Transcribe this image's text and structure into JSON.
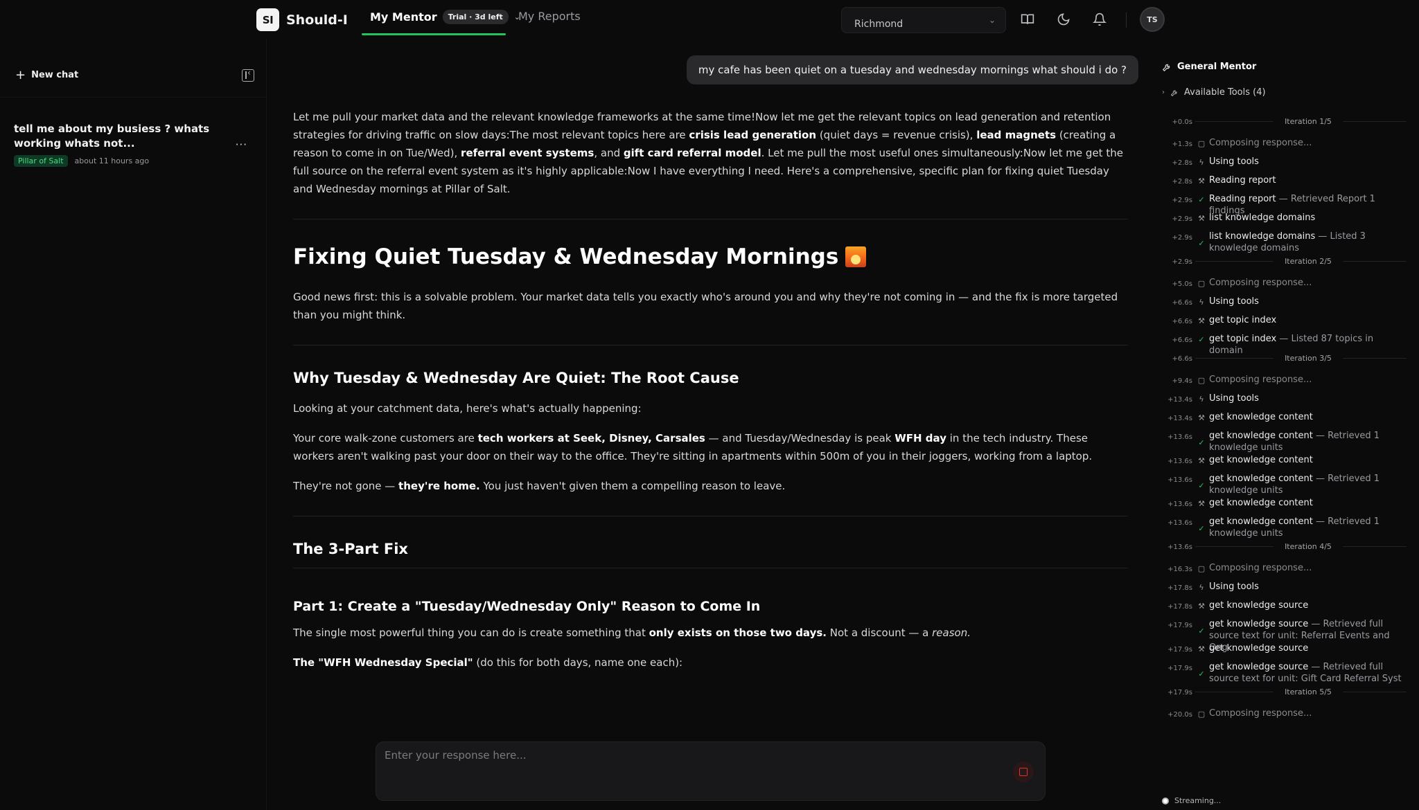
{
  "app": {
    "logo_mark": "SI",
    "name": "Should-I"
  },
  "nav": {
    "mentor_label": "My Mentor",
    "trial_badge": "Trial · 3d left",
    "reports_label": "My Reports",
    "active_color": "#22c55e"
  },
  "location": {
    "value": "Richmond"
  },
  "user": {
    "initials": "TS"
  },
  "sidebar": {
    "new_chat_label": "New chat",
    "chats": [
      {
        "title": "tell me about my busiess ? whats working whats not...",
        "tag": "Pillar of Salt",
        "time": "about 11 hours ago"
      }
    ]
  },
  "conversation": {
    "user_message": "my cafe has been quiet on a tuesday and wednesday mornings what should i do ?",
    "intro": {
      "t1": "Let me pull your market data and the relevant knowledge frameworks at the same time!Now let me get the relevant topics on lead generation and retention strategies for driving traffic on slow days:The most relevant topics here are ",
      "b1": "crisis lead generation",
      "t2": " (quiet days = revenue crisis), ",
      "b2": "lead magnets",
      "t3": " (creating a reason to come in on Tue/Wed), ",
      "b3": "referral event systems",
      "t4": ", and ",
      "b4": "gift card referral model",
      "t5": ". Let me pull the most useful ones simultaneously:Now let me get the full source on the referral event system as it's highly applicable:Now I have everything I need. Here's a comprehensive, specific plan for fixing quiet Tuesday and Wednesday mornings at Pillar of Salt."
    },
    "h1": "Fixing Quiet Tuesday & Wednesday Mornings",
    "good_news": "Good news first: this is a solvable problem. Your market data tells you exactly who's around you and why they're not coming in — and the fix is more targeted than you might think.",
    "h2_root": "Why Tuesday & Wednesday Are Quiet: The Root Cause",
    "catchment": "Looking at your catchment data, here's what's actually happening:",
    "walkzone": {
      "t1": "Your core walk-zone customers are ",
      "b1": "tech workers at Seek, Disney, Carsales",
      "t2": " — and Tuesday/Wednesday is peak ",
      "b2": "WFH day",
      "t3": " in the tech industry. These workers aren't walking past your door on their way to the office. They're sitting in apartments within 500m of you in their joggers, working from a laptop."
    },
    "not_gone": {
      "t1": "They're not gone — ",
      "b1": "they're home.",
      "t2": " You just haven't given them a compelling reason to leave."
    },
    "h2_fix": "The 3-Part Fix",
    "h3_part1": "Part 1: Create a \"Tuesday/Wednesday Only\" Reason to Come In",
    "powerful": {
      "t1": "The single most powerful thing you can do is create something that ",
      "b1": "only exists on those two days.",
      "t2": " Not a discount — a ",
      "i1": "reason."
    },
    "special": {
      "b1": "The \"WFH Wednesday Special\"",
      "t1": " (do this for both days, name one each):"
    }
  },
  "composer": {
    "placeholder": "Enter your response here...",
    "stop_color": "#dd3333"
  },
  "panel": {
    "title": "General Mentor",
    "tools_label": "Available Tools (4)",
    "streaming": "Streaming...",
    "timeline": [
      {
        "kind": "iter",
        "time": "+0.0s",
        "label": "Iteration 1/5"
      },
      {
        "kind": "compose",
        "time": "+1.3s",
        "text": "Composing response..."
      },
      {
        "kind": "tools",
        "time": "+2.8s",
        "text": "Using tools"
      },
      {
        "kind": "call",
        "time": "+2.8s",
        "text": "Reading report"
      },
      {
        "kind": "done",
        "time": "+2.9s",
        "text": "Reading report",
        "detail": " — Retrieved Report 1 findings"
      },
      {
        "kind": "call",
        "time": "+2.9s",
        "text": "list knowledge domains"
      },
      {
        "kind": "done",
        "time": "+2.9s",
        "text": "list knowledge domains",
        "detail": " — Listed 3 knowledge domains",
        "lines": 2
      },
      {
        "kind": "iter",
        "time": "+2.9s",
        "label": "Iteration 2/5"
      },
      {
        "kind": "compose",
        "time": "+5.0s",
        "text": "Composing response..."
      },
      {
        "kind": "tools",
        "time": "+6.6s",
        "text": "Using tools"
      },
      {
        "kind": "call",
        "time": "+6.6s",
        "text": "get topic index"
      },
      {
        "kind": "done",
        "time": "+6.6s",
        "text": "get topic index",
        "detail": " — Listed 87 topics in domain"
      },
      {
        "kind": "iter",
        "time": "+6.6s",
        "label": "Iteration 3/5"
      },
      {
        "kind": "compose",
        "time": "+9.4s",
        "text": "Composing response..."
      },
      {
        "kind": "tools",
        "time": "+13.4s",
        "text": "Using tools"
      },
      {
        "kind": "call",
        "time": "+13.4s",
        "text": "get knowledge content"
      },
      {
        "kind": "done",
        "time": "+13.6s",
        "text": "get knowledge content",
        "detail": " — Retrieved 1 knowledge units",
        "lines": 2
      },
      {
        "kind": "call",
        "time": "+13.6s",
        "text": "get knowledge content"
      },
      {
        "kind": "done",
        "time": "+13.6s",
        "text": "get knowledge content",
        "detail": " — Retrieved 1 knowledge units",
        "lines": 2
      },
      {
        "kind": "call",
        "time": "+13.6s",
        "text": "get knowledge content"
      },
      {
        "kind": "done",
        "time": "+13.6s",
        "text": "get knowledge content",
        "detail": " — Retrieved 1 knowledge units",
        "lines": 2
      },
      {
        "kind": "iter",
        "time": "+13.6s",
        "label": "Iteration 4/5"
      },
      {
        "kind": "compose",
        "time": "+16.3s",
        "text": "Composing response..."
      },
      {
        "kind": "tools",
        "time": "+17.8s",
        "text": "Using tools"
      },
      {
        "kind": "call",
        "time": "+17.8s",
        "text": "get knowledge source"
      },
      {
        "kind": "done",
        "time": "+17.9s",
        "text": "get knowledge source",
        "detail": " — Retrieved full source text for unit: Referral Events and Ong",
        "lines": 2
      },
      {
        "kind": "call",
        "time": "+17.9s",
        "text": "get knowledge source"
      },
      {
        "kind": "done",
        "time": "+17.9s",
        "text": "get knowledge source",
        "detail": " — Retrieved full source text for unit: Gift Card Referral Syst",
        "lines": 2
      },
      {
        "kind": "iter",
        "time": "+17.9s",
        "label": "Iteration 5/5"
      },
      {
        "kind": "compose",
        "time": "+20.0s",
        "text": "Composing response..."
      }
    ]
  }
}
